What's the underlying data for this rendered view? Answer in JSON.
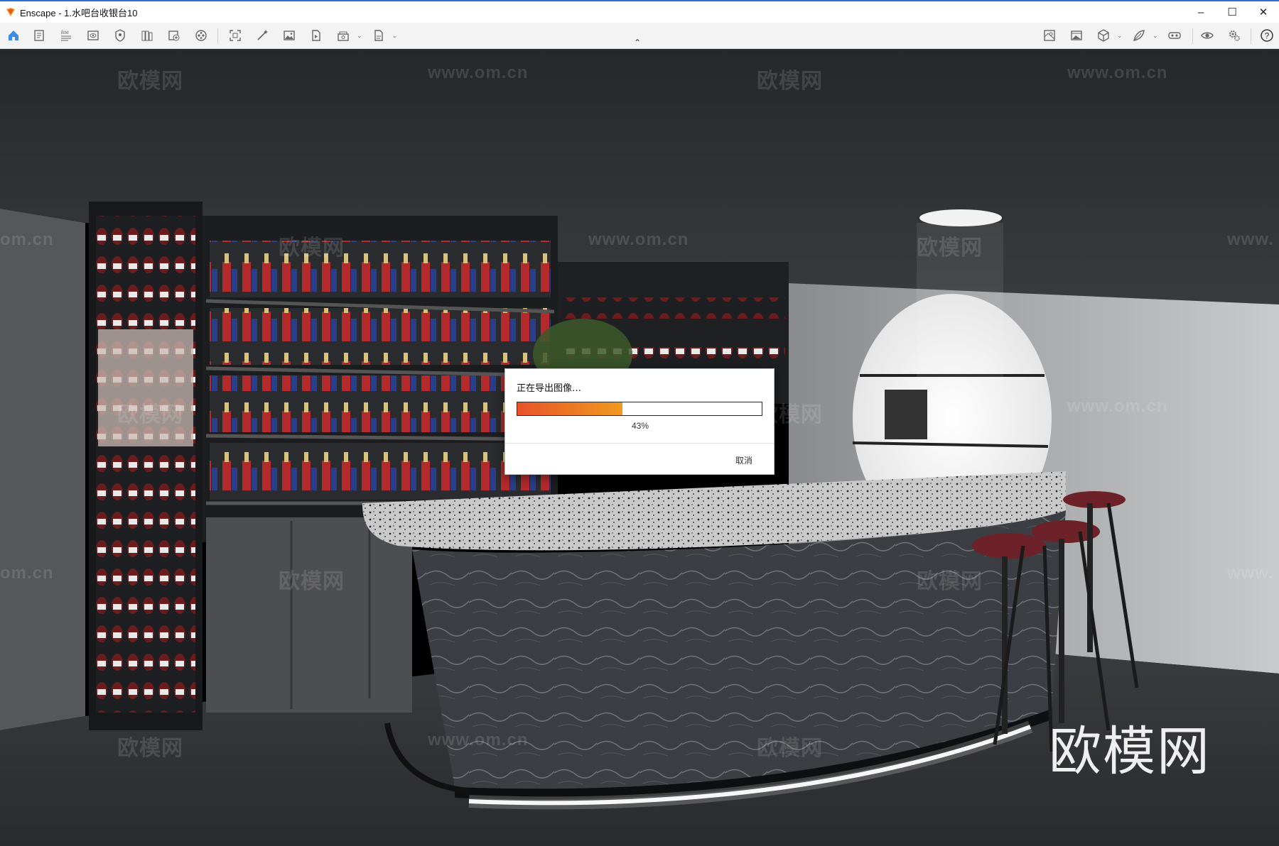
{
  "window": {
    "app_name": "Enscape",
    "title": "Enscape - 1.水吧台收银台10",
    "minimize": "–",
    "maximize": "☐",
    "close": "✕"
  },
  "toolbar": {
    "left_icons": [
      "home-icon",
      "document-icon",
      "bim-info-icon",
      "view-icon",
      "asset-icon",
      "library-icon",
      "material-icon",
      "vr-icon",
      "capture-icon",
      "magic-icon",
      "image-icon",
      "export-video-icon",
      "batch-icon",
      "export-file-icon"
    ],
    "right_icons": [
      "map-icon",
      "gallery-icon",
      "cube-icon",
      "leaf-icon",
      "vr-headset-icon",
      "eye-icon",
      "settings-icon",
      "help-icon"
    ],
    "collapse": "⌃",
    "help": "?"
  },
  "watermarks": {
    "logo_text": "欧模网",
    "url_text": "www.om.cn",
    "partial_left": "om.cn",
    "partial_right": "www."
  },
  "dialog": {
    "message": "正在导出图像…",
    "progress": 0.43,
    "percent_label": "43%",
    "cancel_label": "取消",
    "bar_colors": [
      "#e8532a",
      "#f09a1e"
    ]
  }
}
